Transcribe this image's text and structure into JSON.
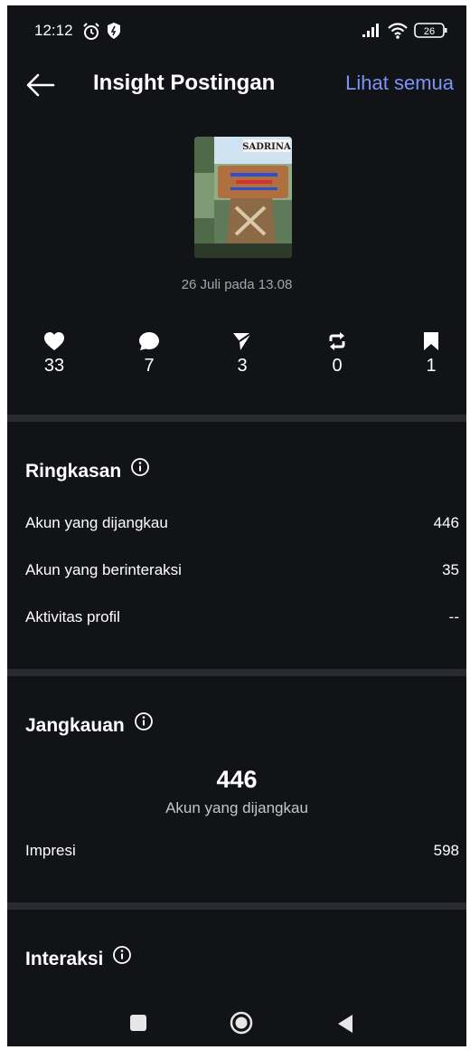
{
  "status_bar": {
    "time": "12:12",
    "battery": "26",
    "icons": [
      "alarm-icon",
      "shield-icon",
      "signal-icon",
      "wifi-icon",
      "battery-icon"
    ]
  },
  "header": {
    "title": "Insight Postingan",
    "see_all": "Lihat semua"
  },
  "post": {
    "date": "26 Juli pada 13.08",
    "thumbnail_brand": "SADRINA"
  },
  "stats": [
    {
      "icon": "heart-icon",
      "value": "33"
    },
    {
      "icon": "comment-icon",
      "value": "7"
    },
    {
      "icon": "share-icon",
      "value": "3"
    },
    {
      "icon": "repost-icon",
      "value": "0"
    },
    {
      "icon": "bookmark-icon",
      "value": "1"
    }
  ],
  "ringkasan": {
    "title": "Ringkasan",
    "rows": [
      {
        "label": "Akun yang dijangkau",
        "value": "446"
      },
      {
        "label": "Akun yang berinteraksi",
        "value": "35"
      },
      {
        "label": "Aktivitas profil",
        "value": "--"
      }
    ]
  },
  "jangkauan": {
    "title": "Jangkauan",
    "big_value": "446",
    "big_label": "Akun yang dijangkau",
    "rows": [
      {
        "label": "Impresi",
        "value": "598"
      }
    ]
  },
  "interaksi": {
    "title": "Interaksi"
  },
  "colors": {
    "background": "#121317",
    "divider": "#2a2b30",
    "link": "#7b93f6",
    "muted_text": "#a2a6ad"
  }
}
